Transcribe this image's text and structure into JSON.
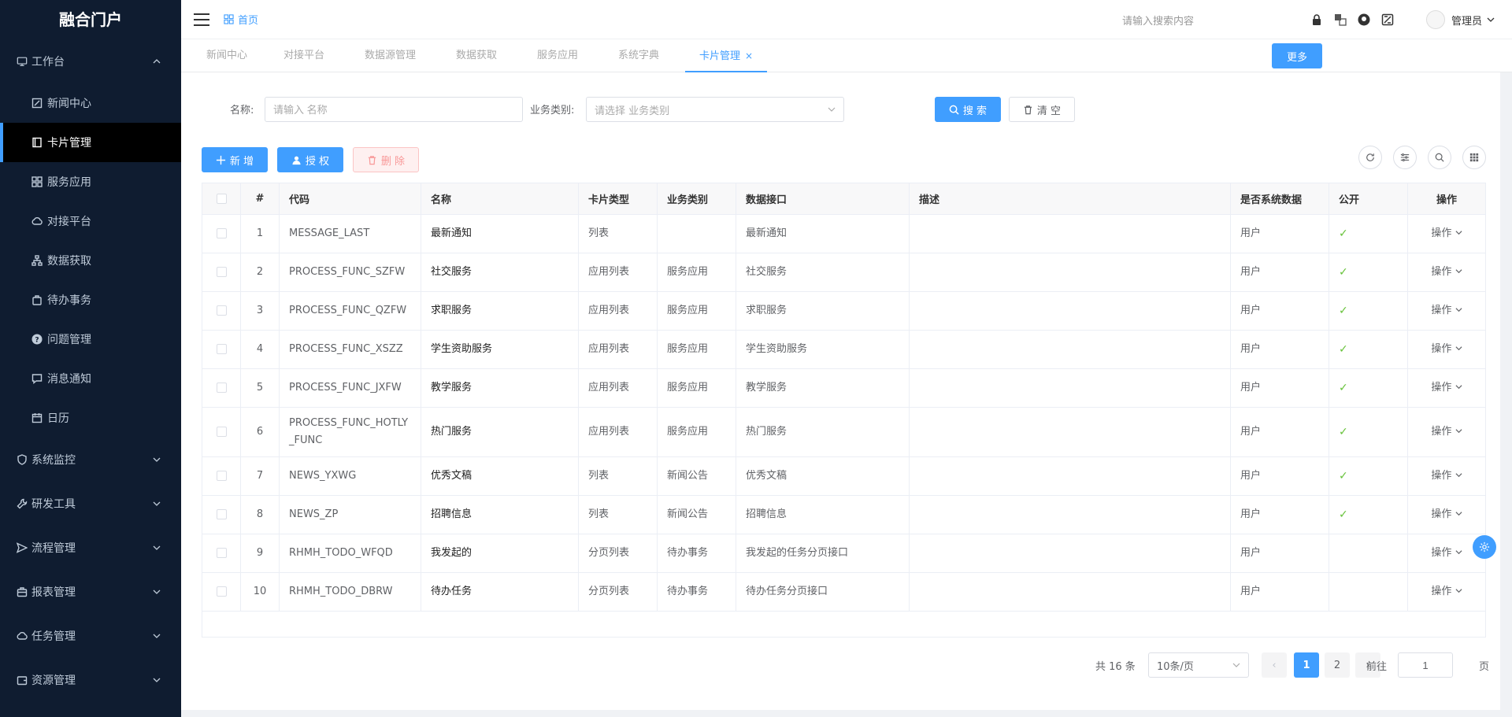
{
  "app": {
    "title": "融合门户"
  },
  "sidebar": {
    "workbench": {
      "label": "工作台",
      "icon": "monitor-icon"
    },
    "items": [
      {
        "label": "新闻中心",
        "icon": "edit-icon"
      },
      {
        "label": "卡片管理",
        "icon": "book-icon"
      },
      {
        "label": "服务应用",
        "icon": "grid-icon"
      },
      {
        "label": "对接平台",
        "icon": "cloud-icon"
      },
      {
        "label": "数据获取",
        "icon": "tree-icon"
      },
      {
        "label": "待办事务",
        "icon": "bag-icon"
      },
      {
        "label": "问题管理",
        "icon": "question-icon"
      },
      {
        "label": "消息通知",
        "icon": "message-icon"
      },
      {
        "label": "日历",
        "icon": "calendar-icon"
      }
    ],
    "groups": [
      {
        "label": "系统监控",
        "icon": "shield-icon"
      },
      {
        "label": "研发工具",
        "icon": "wrench-icon"
      },
      {
        "label": "流程管理",
        "icon": "send-icon"
      },
      {
        "label": "报表管理",
        "icon": "briefcase-icon"
      },
      {
        "label": "任务管理",
        "icon": "cloud-icon"
      },
      {
        "label": "资源管理",
        "icon": "wallet-icon"
      }
    ]
  },
  "header": {
    "breadcrumb": "首页",
    "search_placeholder": "请输入搜索内容",
    "user": "管理员"
  },
  "tabs": [
    "新闻中心",
    "对接平台",
    "数据源管理",
    "数据获取",
    "服务应用",
    "系统字典",
    "卡片管理"
  ],
  "tab_close": "×",
  "more_button": "更多",
  "filter": {
    "name_label": "名称:",
    "name_placeholder": "请输入 名称",
    "category_label": "业务类别:",
    "category_placeholder": "请选择 业务类别",
    "search_button": "搜 索",
    "clear_button": "清 空"
  },
  "toolbar": {
    "add": "新 增",
    "grant": "授 权",
    "delete": "删 除"
  },
  "table": {
    "headers": [
      "#",
      "代码",
      "名称",
      "卡片类型",
      "业务类别",
      "数据接口",
      "描述",
      "是否系统数据",
      "公开",
      "操作"
    ],
    "check_mark": "✓",
    "op_label": "操作",
    "rows": [
      {
        "idx": "1",
        "code": "MESSAGE_LAST",
        "name": "最新通知",
        "type": "列表",
        "cat": "",
        "api": "最新通知",
        "desc": "",
        "sys": "用户",
        "public": true
      },
      {
        "idx": "2",
        "code": "PROCESS_FUNC_SZFW",
        "name": "社交服务",
        "type": "应用列表",
        "cat": "服务应用",
        "api": "社交服务",
        "desc": "",
        "sys": "用户",
        "public": true
      },
      {
        "idx": "3",
        "code": "PROCESS_FUNC_QZFW",
        "name": "求职服务",
        "type": "应用列表",
        "cat": "服务应用",
        "api": "求职服务",
        "desc": "",
        "sys": "用户",
        "public": true
      },
      {
        "idx": "4",
        "code": "PROCESS_FUNC_XSZZ",
        "name": "学生资助服务",
        "type": "应用列表",
        "cat": "服务应用",
        "api": "学生资助服务",
        "desc": "",
        "sys": "用户",
        "public": true
      },
      {
        "idx": "5",
        "code": "PROCESS_FUNC_JXFW",
        "name": "教学服务",
        "type": "应用列表",
        "cat": "服务应用",
        "api": "教学服务",
        "desc": "",
        "sys": "用户",
        "public": true
      },
      {
        "idx": "6",
        "code": "PROCESS_FUNC_HOTLY_FUNC",
        "name": "热门服务",
        "type": "应用列表",
        "cat": "服务应用",
        "api": "热门服务",
        "desc": "",
        "sys": "用户",
        "public": true
      },
      {
        "idx": "7",
        "code": "NEWS_YXWG",
        "name": "优秀文稿",
        "type": "列表",
        "cat": "新闻公告",
        "api": "优秀文稿",
        "desc": "",
        "sys": "用户",
        "public": true
      },
      {
        "idx": "8",
        "code": "NEWS_ZP",
        "name": "招聘信息",
        "type": "列表",
        "cat": "新闻公告",
        "api": "招聘信息",
        "desc": "",
        "sys": "用户",
        "public": true
      },
      {
        "idx": "9",
        "code": "RHMH_TODO_WFQD",
        "name": "我发起的",
        "type": "分页列表",
        "cat": "待办事务",
        "api": "我发起的任务分页接口",
        "desc": "",
        "sys": "用户",
        "public": false
      },
      {
        "idx": "10",
        "code": "RHMH_TODO_DBRW",
        "name": "待办任务",
        "type": "分页列表",
        "cat": "待办事务",
        "api": "待办任务分页接口",
        "desc": "",
        "sys": "用户",
        "public": false
      }
    ]
  },
  "pagination": {
    "total": "共 16 条",
    "page_size": "10条/页",
    "pages": [
      "1",
      "2"
    ],
    "current": "1",
    "goto_prefix": "前往",
    "goto_value": "1",
    "goto_suffix": "页",
    "prev": "‹",
    "next": "›"
  },
  "colors": {
    "primary": "#409eff",
    "sidebar_bg": "#0f1c30",
    "success": "#67c23a",
    "danger": "#f56c6c"
  }
}
